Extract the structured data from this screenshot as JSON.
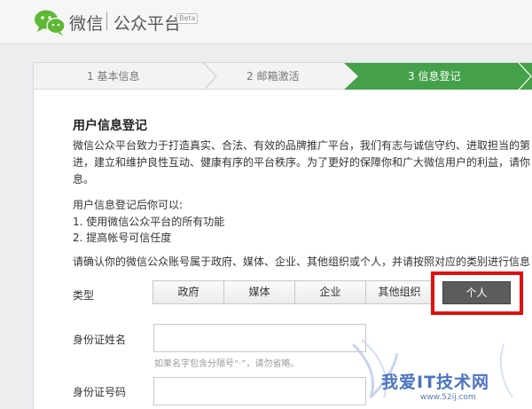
{
  "header": {
    "brand": "微信",
    "sub": "公众平台",
    "beta": "Beta"
  },
  "steps": [
    {
      "label": "1 基本信息",
      "active": false
    },
    {
      "label": "2 邮箱激活",
      "active": false
    },
    {
      "label": "3 信息登记",
      "active": true
    }
  ],
  "content": {
    "title": "用户信息登记",
    "para_line1": "微信公众平台致力于打造真实、合法、有效的品牌推广平台，我们有志与诚信守约、进取担当的第",
    "para_line2": "进，建立和维护良性互动、健康有序的平台秩序。为了更好的保障你和广大微信用户的利益，请你",
    "para_line3": "息。",
    "list_title": "用户信息登记后你可以:",
    "list_items": [
      "1. 使用微信公众平台的所有功能",
      "2. 提高帐号可信任度"
    ],
    "confirm": "请确认你的微信公众账号属于政府、媒体、企业、其他组织或个人，并请按照对应的类别进行信息"
  },
  "form": {
    "type_label": "类型",
    "types": [
      "政府",
      "媒体",
      "企业",
      "其他组织",
      "个人"
    ],
    "selected_type": "个人",
    "name_label": "身份证姓名",
    "name_value": "",
    "name_hint": "如果名字包含分隔号“·”，请勿省略。",
    "id_label": "身份证号码",
    "id_value": ""
  },
  "watermark": {
    "text": "我爱IT技术网",
    "url": "www.52ij.com"
  },
  "colors": {
    "accent_green": "#45a04a",
    "highlight_red": "#e01010",
    "selected_gray": "#5c5c5c"
  }
}
